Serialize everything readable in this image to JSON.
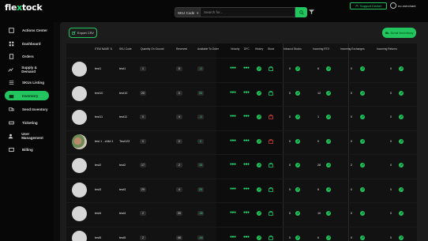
{
  "app": {
    "logo_prefix": "fle",
    "logo_x": "x",
    "logo_suffix": "tock"
  },
  "search": {
    "select_label": "SKU Code",
    "placeholder": "Search for..."
  },
  "header": {
    "support_label": "Support Center",
    "user_name": "eo-merchant"
  },
  "sidebar": {
    "items": [
      {
        "label": "Actions Center",
        "icon": "tasks-icon"
      },
      {
        "label": "Dashboard",
        "icon": "dashboard-icon"
      },
      {
        "label": "Orders",
        "icon": "orders-icon"
      },
      {
        "label": "Supply & Demand",
        "icon": "supply-icon"
      },
      {
        "label": "SKUs Listing",
        "icon": "sku-icon"
      },
      {
        "label": "Inventory",
        "icon": "inventory-icon",
        "active": true
      },
      {
        "label": "Send Inventory",
        "icon": "send-icon"
      },
      {
        "label": "Ticketing",
        "icon": "ticket-icon"
      },
      {
        "label": "User Management",
        "icon": "user-icon"
      },
      {
        "label": "Billing",
        "icon": "billing-icon"
      }
    ]
  },
  "toolbar": {
    "export_label": "Export CSV",
    "send_label": "Send Inventory"
  },
  "table": {
    "headers": {
      "item_name": "ITEM NAME",
      "sku": "SKU Code",
      "qty": "Quantity On Ground",
      "reserved": "Reserved",
      "available": "Available To Order",
      "velocity": "Velocity",
      "dfc": "DFC",
      "history": "History",
      "stock": "Stock",
      "inbound": "Inbound Stocks",
      "rto": "Incoming RTO",
      "exchanges": "Incoming Exchanges",
      "returns": "Incoming Returns"
    },
    "rows": [
      {
        "name": "test1",
        "sku": "test1",
        "qty": "1",
        "reserved": "8",
        "available": "-4",
        "inbound": "0",
        "rto": "6",
        "exchanges": "0",
        "returns": "0",
        "stock_red": false,
        "photo": false
      },
      {
        "name": "test10",
        "sku": "test10",
        "qty": "20",
        "reserved": "0",
        "available": "20",
        "inbound": "0",
        "rto": "12",
        "exchanges": "0",
        "returns": "0",
        "stock_red": false,
        "photo": false
      },
      {
        "name": "test11",
        "sku": "test11",
        "qty": "0",
        "reserved": "4",
        "available": "-4",
        "inbound": "0",
        "rto": "1",
        "exchanges": "0",
        "returns": "0",
        "stock_red": true,
        "photo": false
      },
      {
        "name": "test 1 - child 1",
        "sku": "Test123",
        "qty": "0",
        "reserved": "0",
        "available": "0",
        "inbound": "0",
        "rto": "0",
        "exchanges": "0",
        "returns": "0",
        "stock_red": true,
        "photo": true
      },
      {
        "name": "test2",
        "sku": "test2",
        "qty": "17",
        "reserved": "2",
        "available": "15",
        "inbound": "0",
        "rto": "28",
        "exchanges": "2",
        "returns": "0",
        "stock_red": false,
        "photo": false
      },
      {
        "name": "test3",
        "sku": "test3",
        "qty": "29",
        "reserved": "4",
        "available": "25",
        "inbound": "0",
        "rto": "6",
        "exchanges": "0",
        "returns": "0",
        "stock_red": false,
        "photo": false
      },
      {
        "name": "test4",
        "sku": "test4",
        "qty": "2",
        "reserved": "39",
        "available": "-35",
        "inbound": "0",
        "rto": "10",
        "exchanges": "0",
        "returns": "0",
        "stock_red": false,
        "photo": false
      },
      {
        "name": "test5",
        "sku": "test5",
        "qty": "2",
        "reserved": "46",
        "available": "-44",
        "inbound": "0",
        "rto": "6",
        "exchanges": "0",
        "returns": "0",
        "stock_red": false,
        "photo": false
      }
    ]
  },
  "colors": {
    "accent": "#22c55e",
    "background": "#0b0b0b",
    "panel": "#1c1c1c"
  }
}
